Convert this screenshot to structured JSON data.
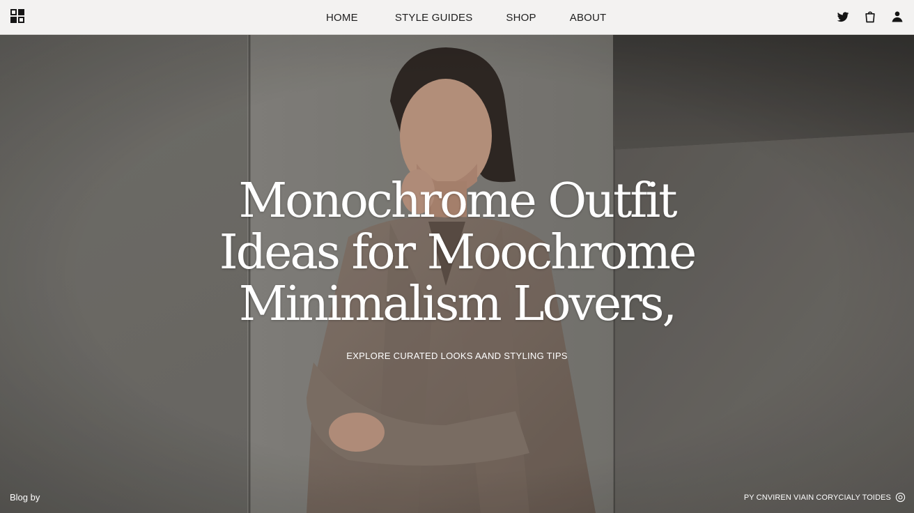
{
  "nav": {
    "logo_icon": "brand-logo-icon",
    "links": [
      "HOME",
      "STYLE GUIDES",
      "SHOP",
      "ABOUT"
    ],
    "icons": [
      "twitter-icon",
      "shopping-bag-icon",
      "user-icon"
    ]
  },
  "hero": {
    "headline_lines": [
      "Monochrome Outfit",
      "Ideas for Moochrome",
      "Minimalism Lovers,"
    ],
    "subheadline": "EXPLORE CURATED LOOKS  AAND STYLING TIPS",
    "background_image": "woman-in-taupe-blazer-photo"
  },
  "footer": {
    "left_text": "Blog by",
    "right_text": "PY CNVIREN VIAIN CORYCIALY TOIDES",
    "right_icon": "copyright-icon"
  },
  "colors": {
    "nav_background": "#f3f2f1",
    "text_primary": "#1d1d1d",
    "hero_text": "#ffffff"
  }
}
